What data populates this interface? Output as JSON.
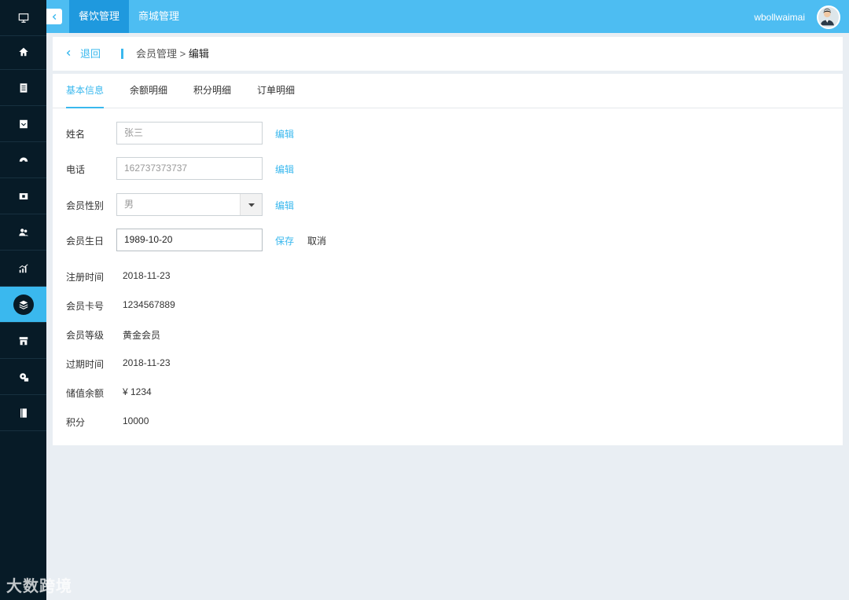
{
  "topbar": {
    "tabs": [
      "餐饮管理",
      "商城管理"
    ],
    "username": "wbollwaimai"
  },
  "sidebar": {
    "items": [
      "monitor-icon",
      "home-icon",
      "document-icon",
      "inbox-icon",
      "cloud-icon",
      "wallet-icon",
      "users-icon",
      "chart-icon",
      "layers-icon",
      "store-icon",
      "settings-icon",
      "book-icon"
    ],
    "active_index": 8
  },
  "breadcrumb": {
    "back_label": "退回",
    "path": "会员管理 > ",
    "current": "编辑"
  },
  "tabs": [
    "基本信息",
    "余额明细",
    "积分明细",
    "订单明细"
  ],
  "form": {
    "name_label": "姓名",
    "name_value": "张三",
    "phone_label": "电话",
    "phone_value": "162737373737",
    "gender_label": "会员性别",
    "gender_value": "男",
    "birthday_label": "会员生日",
    "birthday_value": "1989-10-20",
    "edit_label": "编辑",
    "save_label": "保存",
    "cancel_label": "取消"
  },
  "info": [
    {
      "label": "注册时间",
      "value": "2018-11-23"
    },
    {
      "label": "会员卡号",
      "value": "1234567889"
    },
    {
      "label": "会员等级",
      "value": "黄金会员"
    },
    {
      "label": "过期时间",
      "value": "2018-11-23"
    },
    {
      "label": "储值余额",
      "value": "¥ 1234"
    },
    {
      "label": "积分",
      "value": "10000"
    }
  ],
  "watermark": "大数跨境"
}
